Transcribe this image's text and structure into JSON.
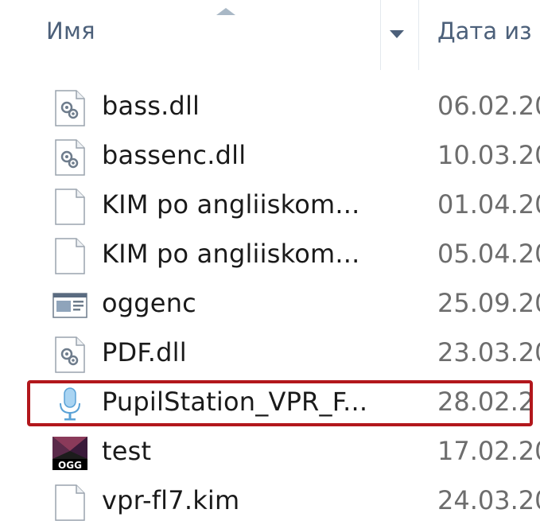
{
  "header": {
    "name_column_label": "Имя",
    "date_column_label": "Дата из"
  },
  "files": [
    {
      "name": "bass.dll",
      "date": "06.02.20",
      "icon": "dll-file-icon"
    },
    {
      "name": "bassenc.dll",
      "date": "10.03.20",
      "icon": "dll-file-icon"
    },
    {
      "name": "KIM po angliiskom...",
      "date": "01.04.20",
      "icon": "blank-file-icon"
    },
    {
      "name": "KIM po angliiskom...",
      "date": "05.04.20",
      "icon": "blank-file-icon"
    },
    {
      "name": "oggenc",
      "date": "25.09.20",
      "icon": "console-app-icon"
    },
    {
      "name": "PDF.dll",
      "date": "23.03.20",
      "icon": "dll-file-icon"
    },
    {
      "name": "PupilStation_VPR_F...",
      "date": "28.02.2",
      "icon": "microphone-app-icon",
      "highlighted": true
    },
    {
      "name": "test",
      "date": "17.02.20",
      "icon": "ogg-file-icon"
    },
    {
      "name": "vpr-fl7.kim",
      "date": "24.03.20",
      "icon": "blank-file-icon"
    }
  ],
  "colors": {
    "header_text": "#4c607a",
    "highlight_border": "#b2171c"
  }
}
